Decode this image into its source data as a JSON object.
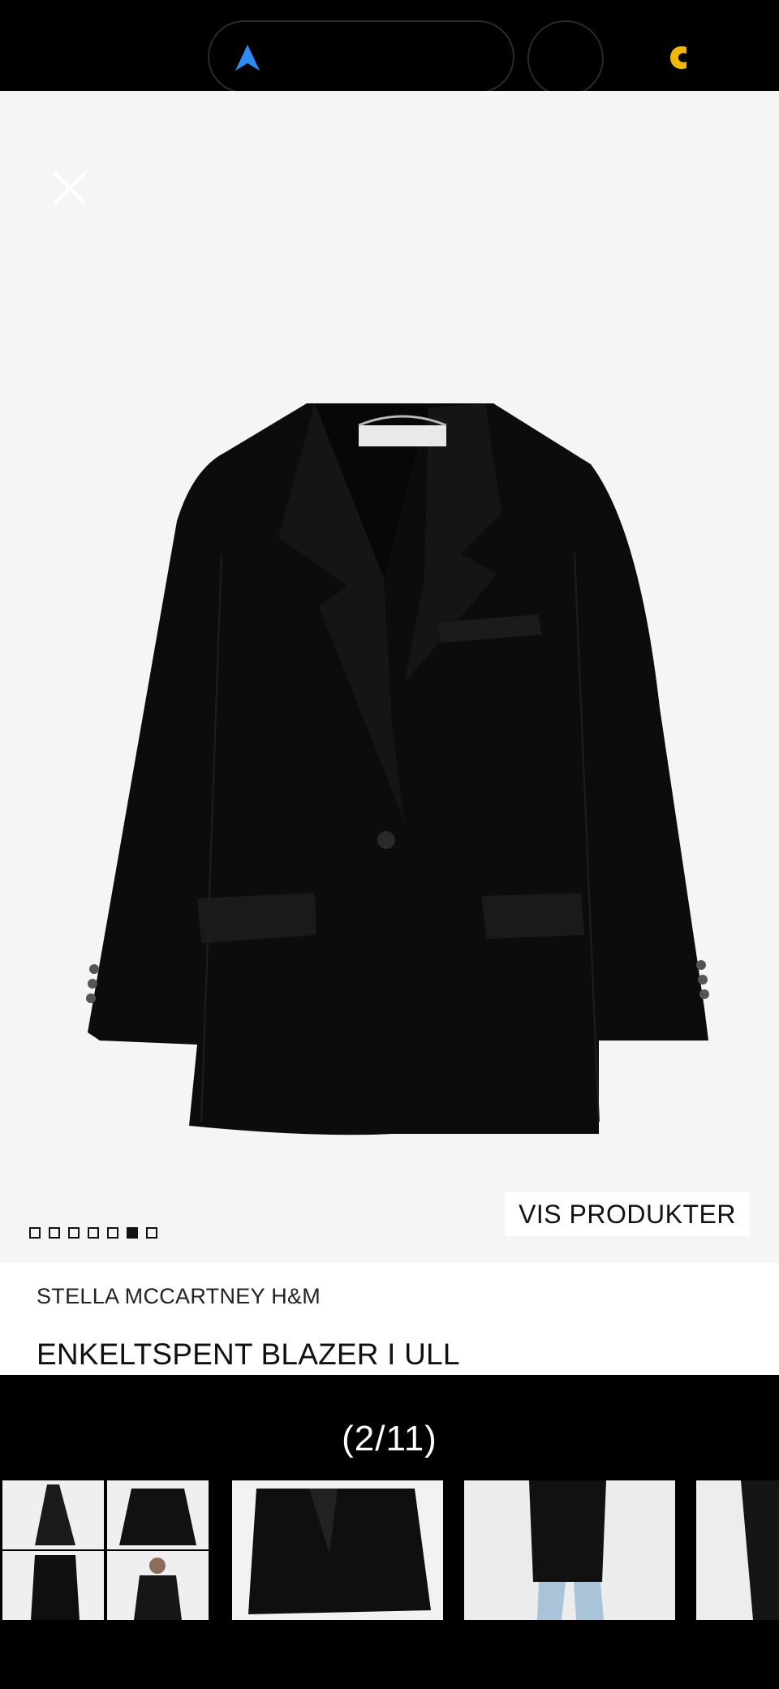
{
  "viewer": {
    "brand": "STELLA MCCARTNEY H&M",
    "product_name": "ENKELTSPENT BLAZER I ULL",
    "show_products_label": "VIS PRODUKTER",
    "dots_total": 7,
    "dots_active_index": 5
  },
  "gallery": {
    "counter": "(2/11)"
  },
  "colors": {
    "accent_blue": "#2f8cf5",
    "accent_yellow": "#f2b705",
    "background": "#f5f5f6"
  }
}
